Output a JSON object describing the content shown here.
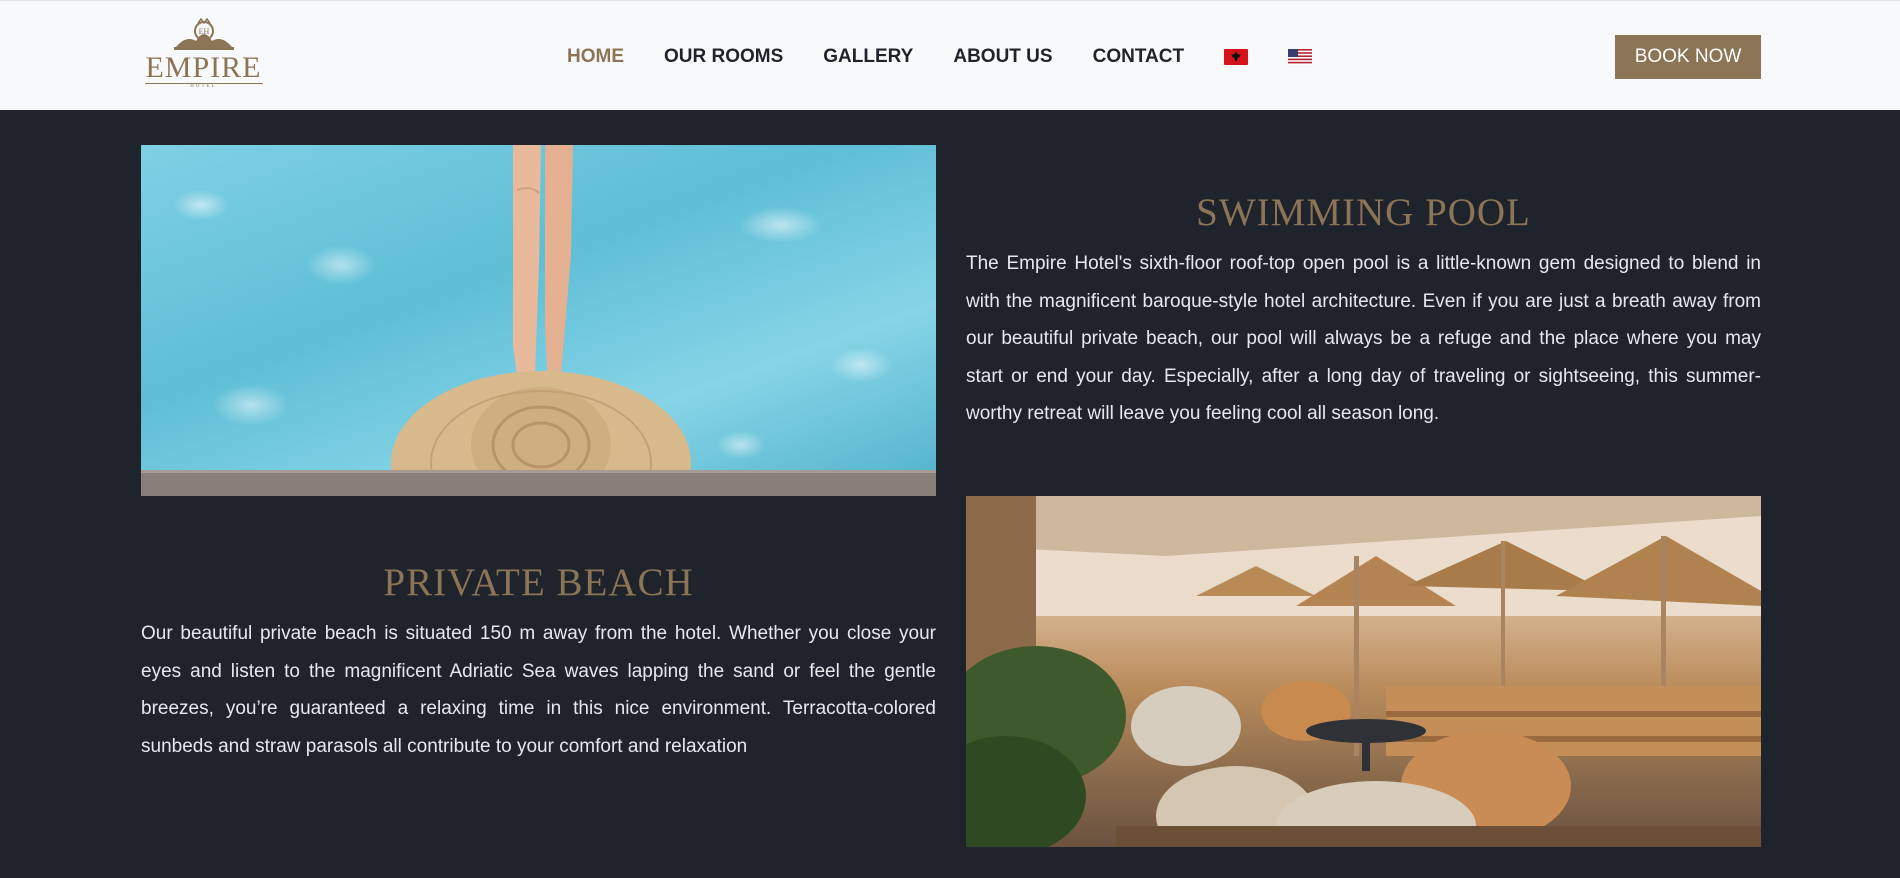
{
  "header": {
    "logo": {
      "name": "EMPIRE",
      "sub": "HOTEL"
    },
    "nav": [
      {
        "label": "HOME",
        "active": true
      },
      {
        "label": "OUR ROOMS",
        "active": false
      },
      {
        "label": "GALLERY",
        "active": false
      },
      {
        "label": "ABOUT US",
        "active": false
      },
      {
        "label": "CONTACT",
        "active": false
      }
    ],
    "flags": [
      "albania-flag-icon",
      "usa-flag-icon"
    ],
    "book_button": "BOOK NOW"
  },
  "sections": {
    "pool": {
      "title": "SWIMMING POOL",
      "text": "The Empire Hotel's sixth-floor roof-top open pool is a little-known gem designed to blend in with the magnificent baroque-style hotel architecture. Even if you are just a breath away from our beautiful private beach, our pool will always be a refuge and the place where you may start or end your day. Especially, after a long day of traveling or sightseeing, this summer-worthy retreat will leave you feeling cool all season long."
    },
    "beach": {
      "title": "PRIVATE BEACH",
      "text": "Our beautiful private beach is situated 150 m away from the hotel. Whether you close your eyes and listen to the magnificent Adriatic Sea waves lapping the sand or feel the gentle breezes, you’re guaranteed a relaxing time in this nice environment. Terracotta-colored sunbeds and straw parasols all contribute to your comfort and relaxation"
    }
  },
  "colors": {
    "accent": "#8c7556",
    "background": "#1f232b",
    "header_bg": "#f8f9fa"
  }
}
